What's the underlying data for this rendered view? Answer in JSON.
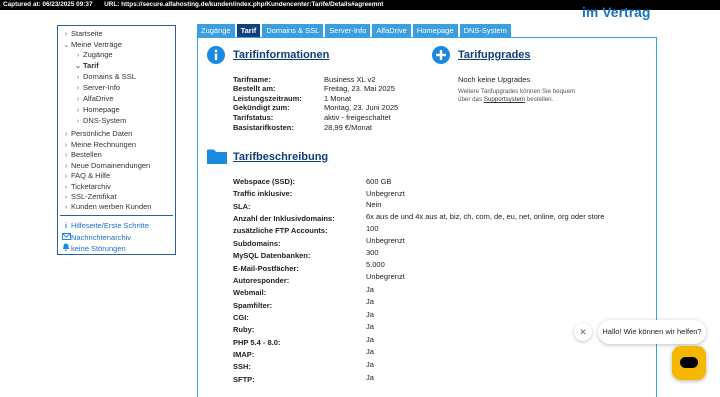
{
  "capture": {
    "captured_label": "Captured at:",
    "captured_at": "06/23/2025 09:37",
    "url_label": "URL:",
    "url": "https://secure.alfahosting.de/kunden/index.php/Kundencenter:Tarife/Details#agreemnt"
  },
  "page": {
    "heading_fragment": "im Vertrag"
  },
  "sidebar": {
    "items": [
      {
        "label": "Startseite",
        "chevron": ">"
      },
      {
        "label": "Meine Verträge",
        "chevron": "v"
      },
      {
        "label": "Zugänge",
        "chevron": ">"
      },
      {
        "label": "Tarif",
        "chevron": "v"
      },
      {
        "label": "Domains & SSL",
        "chevron": ">"
      },
      {
        "label": "Server-Info",
        "chevron": ">"
      },
      {
        "label": "AlfaDrive",
        "chevron": ">"
      },
      {
        "label": "Homepage",
        "chevron": ">"
      },
      {
        "label": "DNS-System",
        "chevron": ">"
      },
      {
        "label": "Persönliche Daten",
        "chevron": ">"
      },
      {
        "label": "Meine Rechnungen",
        "chevron": ">"
      },
      {
        "label": "Bestellen",
        "chevron": ">"
      },
      {
        "label": "Neue Domainendungen",
        "chevron": ">"
      },
      {
        "label": "FAQ & Hilfe",
        "chevron": ">"
      },
      {
        "label": "Ticketarchiv",
        "chevron": ">"
      },
      {
        "label": "SSL-Zertifikat",
        "chevron": ">"
      },
      {
        "label": "Kunden werben Kunden",
        "chevron": ">"
      }
    ],
    "links": [
      {
        "label": "Hilfeseite/Erste Schritte",
        "icon": "info-icon"
      },
      {
        "label": "Nachrichtenarchiv",
        "icon": "mail-icon"
      },
      {
        "label": "keine Störungen",
        "icon": "bell-icon"
      }
    ]
  },
  "tabs": [
    "Zugänge",
    "Tarif",
    "Domains & SSL",
    "Server-Info",
    "AlfaDrive",
    "Homepage",
    "DNS-System"
  ],
  "tarifinfo": {
    "title": "Tarifinformationen",
    "rows": [
      {
        "label": "Tarifname:",
        "value": "Business XL v2"
      },
      {
        "label": "Bestellt am:",
        "value": "Freitag, 23. Mai 2025"
      },
      {
        "label": "Leistungszeitraum:",
        "value": "1 Monat"
      },
      {
        "label": "Gekündigt zum:",
        "value": "Montag, 23. Juni 2025"
      },
      {
        "label": "Tarifstatus:",
        "value": "aktiv - freigeschaltet"
      },
      {
        "label": "Basistarifkosten:",
        "value": "28,99 €/Monat"
      }
    ]
  },
  "upgrades": {
    "title": "Tarifupgrades",
    "none_text": "Noch keine Upgrades",
    "note_line1": "Weitere Tarifupgrades können Sie bequem",
    "note_line2_pre": "über das ",
    "note_link": "Supportsystem",
    "note_line2_post": " bestellen."
  },
  "beschreibung": {
    "title": "Tarifbeschreibung",
    "rows": [
      {
        "label": "Webspace (SSD):",
        "value": "600 GB"
      },
      {
        "label": "Traffic inklusive:",
        "value": "Unbegrenzt"
      },
      {
        "label": "SLA:",
        "value": "Nein"
      },
      {
        "label": "Anzahl der Inklusivdomains:",
        "value": "6x aus de und 4x aus at, biz, ch, com, de, eu, net, online, org oder store"
      },
      {
        "label": "zusätzliche FTP Accounts:",
        "value": "100"
      },
      {
        "label": "Subdomains:",
        "value": "Unbegrenzt"
      },
      {
        "label": "MySQL Datenbanken:",
        "value": "300"
      },
      {
        "label": "E-Mail-Postfächer:",
        "value": "5.000"
      },
      {
        "label": "Autoresponder:",
        "value": "Unbegrenzt"
      },
      {
        "label": "Webmail:",
        "value": "Ja"
      },
      {
        "label": "Spamfilter:",
        "value": "Ja"
      },
      {
        "label": "CGI:",
        "value": "Ja"
      },
      {
        "label": "Ruby:",
        "value": "Ja"
      },
      {
        "label": "PHP 5.4 - 8.0:",
        "value": "Ja"
      },
      {
        "label": "IMAP:",
        "value": "Ja"
      },
      {
        "label": "SSH:",
        "value": "Ja"
      },
      {
        "label": "SFTP:",
        "value": "Ja"
      }
    ]
  },
  "chat": {
    "greeting": "Hallo! Wie können wir helfen?",
    "close_glyph": "✕"
  },
  "colors": {
    "accent": "#3a9ee0",
    "active_tab": "#0d3f7a",
    "chat_button": "#f5b700"
  }
}
